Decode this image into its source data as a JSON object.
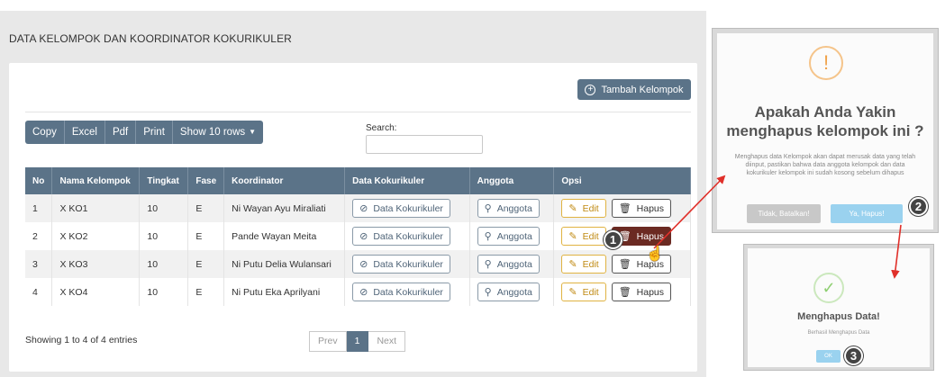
{
  "page": {
    "heading": "DATA KELOMPOK DAN KOORDINATOR KOKURIKULER"
  },
  "toolbar": {
    "add_label": "Tambah Kelompok",
    "export_buttons": [
      "Copy",
      "Excel",
      "Pdf",
      "Print",
      "Show 10 rows"
    ],
    "search_label": "Search:",
    "search_value": ""
  },
  "table": {
    "headers": [
      "No",
      "Nama Kelompok",
      "Tingkat",
      "Fase",
      "Koordinator",
      "Data Kokurikuler",
      "Anggota",
      "Opsi"
    ],
    "rows": [
      {
        "no": "1",
        "nama": "X KO1",
        "tingkat": "10",
        "fase": "E",
        "koordinator": "Ni Wayan Ayu Miraliati"
      },
      {
        "no": "2",
        "nama": "X KO2",
        "tingkat": "10",
        "fase": "E",
        "koordinator": "Pande Wayan Meita"
      },
      {
        "no": "3",
        "nama": "X KO3",
        "tingkat": "10",
        "fase": "E",
        "koordinator": "Ni Putu Delia Wulansari"
      },
      {
        "no": "4",
        "nama": "X KO4",
        "tingkat": "10",
        "fase": "E",
        "koordinator": "Ni Putu Eka Aprilyani"
      }
    ],
    "action_labels": {
      "data_kokurikuler": "Data Kokurikuler",
      "anggota": "Anggota",
      "edit": "Edit",
      "hapus": "Hapus"
    }
  },
  "footer": {
    "info": "Showing 1 to 4 of 4 entries",
    "pager": {
      "prev": "Prev",
      "current": "1",
      "next": "Next"
    }
  },
  "confirm_dialog": {
    "title": "Apakah Anda Yakin menghapus kelompok ini ?",
    "text": "Menghapus data Kelompok akan dapat merusak data yang telah diinput, pastikan bahwa data anggota kelompok dan data kokurikuler kelompok ini sudah kosong sebelum dihapus",
    "cancel_label": "Tidak, Batalkan!",
    "confirm_label": "Ya, Hapus!",
    "icon": "exclamation-icon"
  },
  "success_dialog": {
    "title": "Menghapus Data!",
    "text": "Berhasil Menghapus Data",
    "ok_label": "OK",
    "icon": "checkmark-icon"
  },
  "steps": [
    "1",
    "2",
    "3"
  ],
  "colors": {
    "primary": "#5b7388",
    "edit": "#e0b342",
    "hapus_active": "#6b2a22",
    "arrow": "#e0302a",
    "confirm_btn": "#9ad2ef"
  }
}
